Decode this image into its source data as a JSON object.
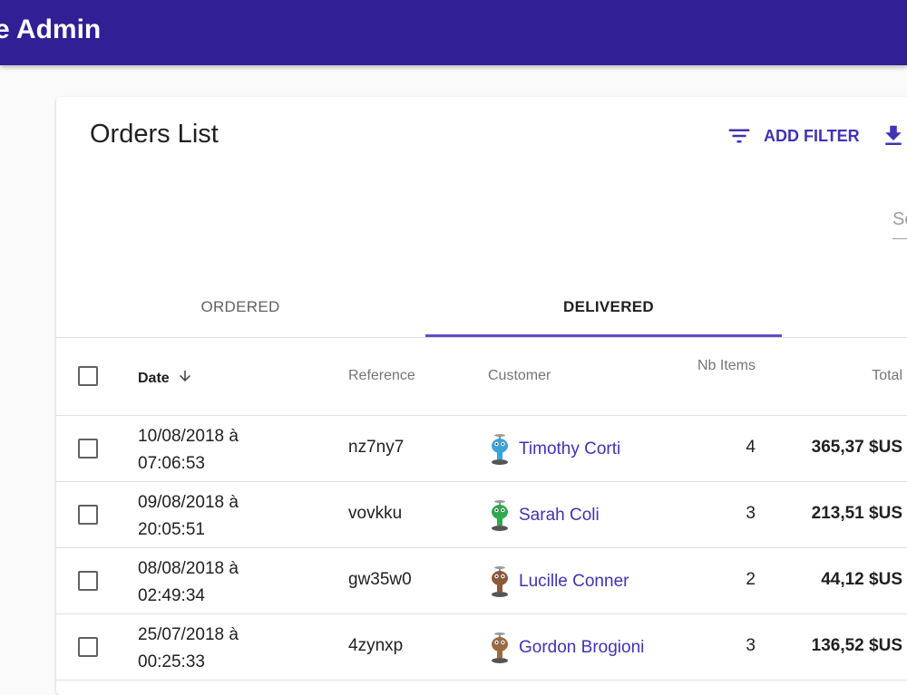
{
  "appbar": {
    "title": "e Admin"
  },
  "card": {
    "title": "Orders List",
    "add_filter_label": "ADD FILTER",
    "search_placeholder": "Se"
  },
  "tabs": [
    {
      "label": "ORDERED",
      "active": false
    },
    {
      "label": "DELIVERED",
      "active": true
    }
  ],
  "table": {
    "headers": {
      "date": "Date",
      "reference": "Reference",
      "customer": "Customer",
      "nb_items": "Nb Items",
      "total": "Total"
    },
    "rows": [
      {
        "date": "10/08/2018 à 07:06:53",
        "reference": "nz7ny7",
        "customer": "Timothy Corti",
        "nb_items": "4",
        "total": "365,37 $US",
        "avatar": "blue-robot-avatar-icon",
        "avatar_color": "#3aa3d8"
      },
      {
        "date": "09/08/2018 à 20:05:51",
        "reference": "vovkku",
        "customer": "Sarah Coli",
        "nb_items": "3",
        "total": "213,51 $US",
        "avatar": "green-robot-avatar-icon",
        "avatar_color": "#2fa84f"
      },
      {
        "date": "08/08/2018 à 02:49:34",
        "reference": "gw35w0",
        "customer": "Lucille Conner",
        "nb_items": "2",
        "total": "44,12 $US",
        "avatar": "brown-robot-avatar-icon",
        "avatar_color": "#8a5a3a"
      },
      {
        "date": "25/07/2018 à 00:25:33",
        "reference": "4zynxp",
        "customer": "Gordon Brogioni",
        "nb_items": "3",
        "total": "136,52 $US",
        "avatar": "brown-robot-avatar-icon",
        "avatar_color": "#9a6a42"
      }
    ]
  },
  "colors": {
    "appbar": "#311f96",
    "accent": "#3f33b5",
    "tab_indicator": "#5b4fc8"
  }
}
